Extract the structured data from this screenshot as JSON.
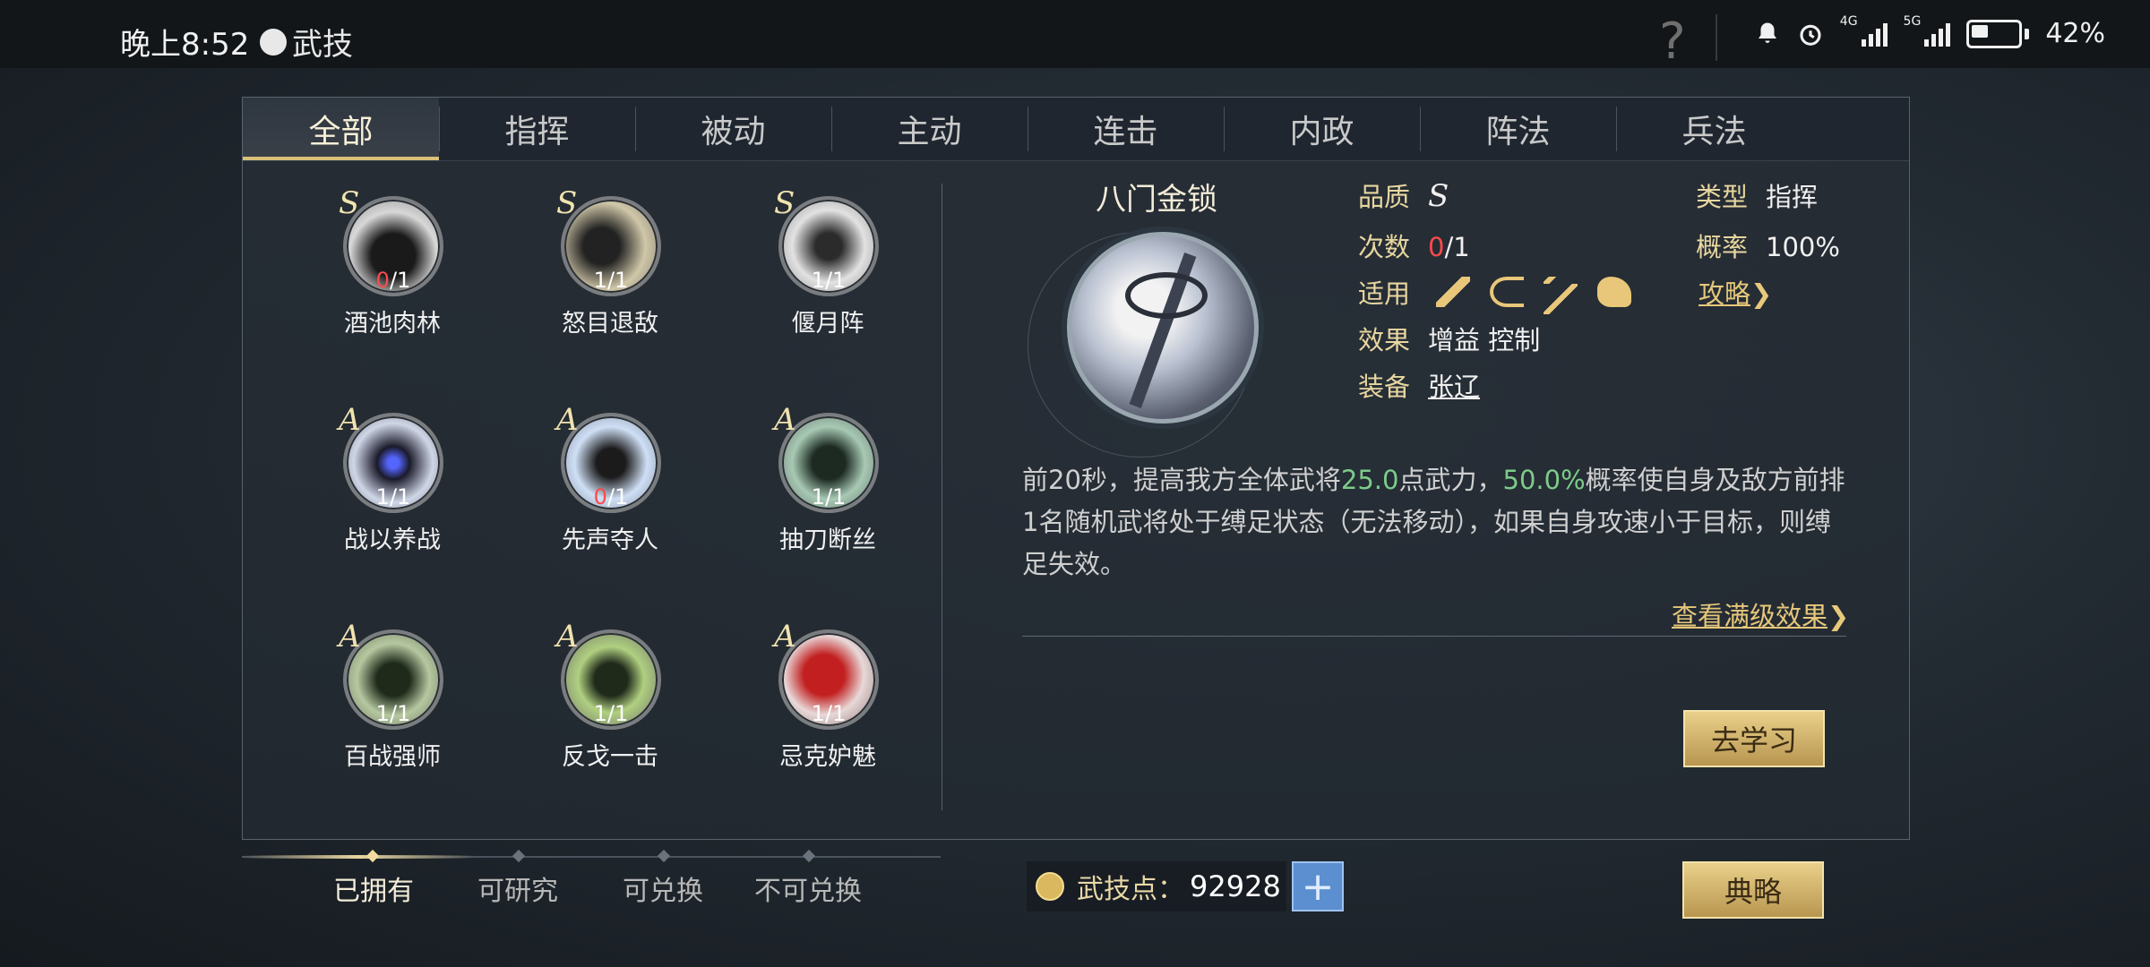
{
  "status_bar": {
    "time": "晚上8:52",
    "app_label": "武技",
    "help": "?",
    "net1": "4G",
    "net2": "5G",
    "battery": "42%"
  },
  "tabs": [
    "全部",
    "指挥",
    "被动",
    "主动",
    "连击",
    "内政",
    "阵法",
    "兵法"
  ],
  "active_tab": "全部",
  "skills": [
    {
      "grade": "S",
      "count_have": "0",
      "count_total": "/1",
      "name": "酒池肉林"
    },
    {
      "grade": "S",
      "count_have": "1",
      "count_total": "/1",
      "name": "怒目退敌"
    },
    {
      "grade": "S",
      "count_have": "1",
      "count_total": "/1",
      "name": "偃月阵"
    },
    {
      "grade": "A",
      "count_have": "1",
      "count_total": "/1",
      "name": "战以养战"
    },
    {
      "grade": "A",
      "count_have": "0",
      "count_total": "/1",
      "name": "先声夺人"
    },
    {
      "grade": "A",
      "count_have": "1",
      "count_total": "/1",
      "name": "抽刀断丝"
    },
    {
      "grade": "A",
      "count_have": "1",
      "count_total": "/1",
      "name": "百战强师"
    },
    {
      "grade": "A",
      "count_have": "1",
      "count_total": "/1",
      "name": "反戈一击"
    },
    {
      "grade": "A",
      "count_have": "1",
      "count_total": "/1",
      "name": "忌克妒魅"
    }
  ],
  "detail": {
    "title": "八门金锁",
    "quality_label": "品质",
    "quality_value": "S",
    "type_label": "类型",
    "type_value": "指挥",
    "times_label": "次数",
    "times_have": "0",
    "times_total": "/1",
    "prob_label": "概率",
    "prob_value": "100%",
    "apply_label": "适用",
    "apply_icons": [
      "sword-icon",
      "bow-icon",
      "spear-icon",
      "horse-icon"
    ],
    "guide_link": "攻略",
    "effect_label": "效果",
    "effect_value": "增益 控制",
    "equip_label": "装备",
    "equip_value": "张辽",
    "desc_part1": "前20秒，提高我方全体武将",
    "desc_hl1": "25.0",
    "desc_part2": "点武力，",
    "desc_hl2": "50.0%",
    "desc_part3": "概率使自身及敌方前排1名随机武将处于缚足状态（无法移动），如果自身攻速小于目标，则缚足失效。",
    "full_effect_link": "查看满级效果",
    "learn_button": "去学习"
  },
  "filters": [
    "已拥有",
    "可研究",
    "可兑换",
    "不可兑换"
  ],
  "active_filter": "已拥有",
  "points": {
    "label": "武技点：",
    "value": "92928",
    "plus": "+"
  },
  "guide_button": "典略",
  "colors": {
    "gold": "#e6c77a",
    "highlight_green": "#7dcc8a",
    "red": "#ff4a4a",
    "accent_blue": "#5b8fcf"
  }
}
